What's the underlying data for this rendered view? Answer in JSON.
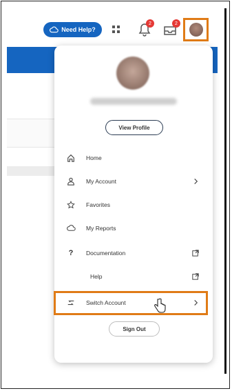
{
  "header": {
    "help_label": "Need Help?",
    "bell_badge": "2",
    "inbox_badge": "2"
  },
  "profile": {
    "view_profile_label": "View Profile"
  },
  "menu": {
    "items": [
      {
        "label": "Home",
        "icon": "home-icon",
        "trail": ""
      },
      {
        "label": "My Account",
        "icon": "person-icon",
        "trail": "chevron-right-icon"
      },
      {
        "label": "Favorites",
        "icon": "star-icon",
        "trail": ""
      },
      {
        "label": "My Reports",
        "icon": "cloud-icon",
        "trail": ""
      },
      {
        "label": "Documentation",
        "icon": "question-icon",
        "trail": "external-link-icon"
      },
      {
        "label": "Help",
        "icon": "",
        "trail": "external-link-icon"
      },
      {
        "label": "Switch Account",
        "icon": "switch-icon",
        "trail": "chevron-right-icon"
      }
    ],
    "sign_out_label": "Sign Out"
  },
  "colors": {
    "brand_blue": "#1565c0",
    "highlight_orange": "#e07b16",
    "badge_red": "#e53935"
  }
}
